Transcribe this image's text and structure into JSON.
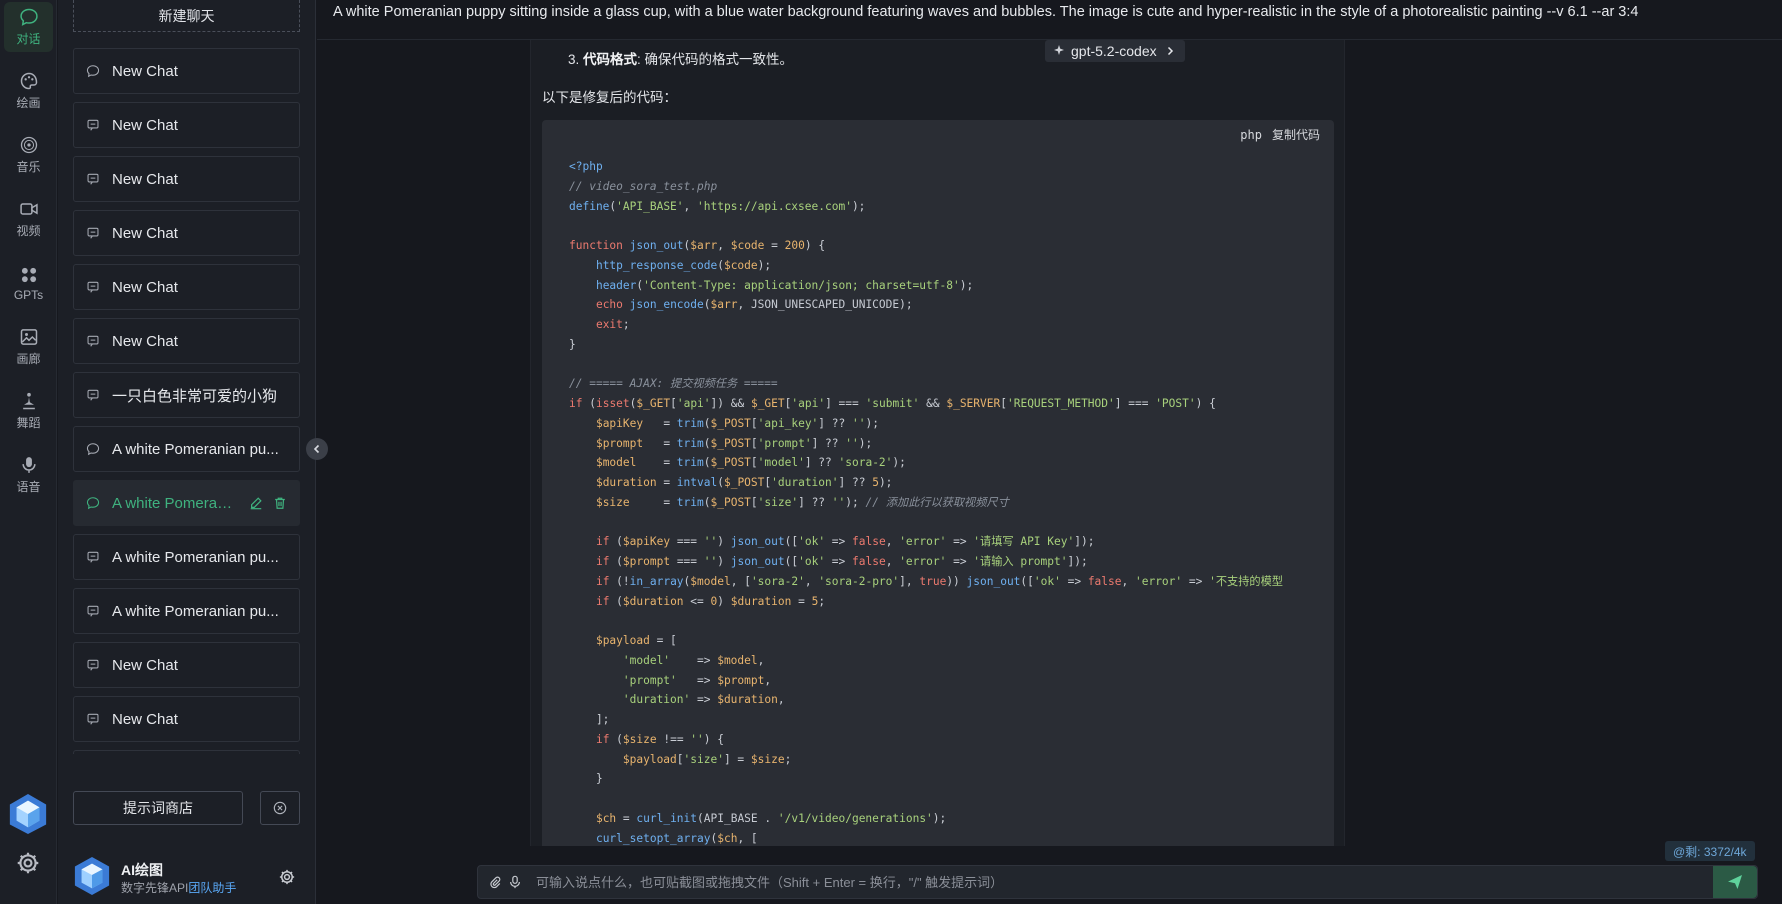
{
  "rail": {
    "items": [
      {
        "label": "对话",
        "icon": "chat-bubble-icon",
        "active": true
      },
      {
        "label": "绘画",
        "icon": "palette-icon"
      },
      {
        "label": "音乐",
        "icon": "music-disc-icon"
      },
      {
        "label": "视频",
        "icon": "video-camera-icon"
      },
      {
        "label": "GPTs",
        "icon": "grid-apps-icon"
      },
      {
        "label": "画廊",
        "icon": "image-gallery-icon"
      },
      {
        "label": "舞蹈",
        "icon": "dance-icon"
      },
      {
        "label": "语音",
        "icon": "microphone-icon"
      }
    ]
  },
  "sidebar": {
    "new_chat_label": "新建聊天",
    "chats": [
      {
        "label": "New Chat",
        "icon": "chat-bubble-icon"
      },
      {
        "label": "New Chat",
        "icon": "message-square-icon"
      },
      {
        "label": "New Chat",
        "icon": "message-square-icon"
      },
      {
        "label": "New Chat",
        "icon": "message-square-icon"
      },
      {
        "label": "New Chat",
        "icon": "message-square-icon"
      },
      {
        "label": "New Chat",
        "icon": "message-square-icon"
      },
      {
        "label": "一只白色非常可爱的小狗",
        "icon": "message-square-icon"
      },
      {
        "label": "A white Pomeranian pu...",
        "icon": "chat-bubble-icon"
      },
      {
        "label": "A white Pomerani...",
        "icon": "chat-bubble-icon",
        "active": true
      },
      {
        "label": "A white Pomeranian pu...",
        "icon": "message-square-icon"
      },
      {
        "label": "A white Pomeranian pu...",
        "icon": "message-square-icon"
      },
      {
        "label": "New Chat",
        "icon": "message-square-icon"
      },
      {
        "label": "New Chat",
        "icon": "message-square-icon"
      },
      {
        "label": "",
        "icon": "message-square-icon"
      }
    ],
    "prompt_store_label": "提示词商店",
    "profile": {
      "name": "AI绘图",
      "subtitle": "数字先锋API",
      "link": "团队助手"
    }
  },
  "header": {
    "title": "A white Pomeranian puppy sitting inside a glass cup, with a blue water background featuring waves and bubbles. The image is cute and hyper-realistic in the style of a photorealistic painting --v 6.1 --ar 3:4"
  },
  "message": {
    "model_label": "gpt-5.2-codex",
    "list_item_number": "3.",
    "list_item_bold": "代码格式",
    "list_item_text": ": 确保代码的格式一致性。",
    "intro": "以下是修复后的代码：",
    "code_lang": "php",
    "copy_label": "复制代码",
    "code_lines": [
      "<?php",
      "// video_sora_test.php",
      "define('API_BASE', 'https://api.cxsee.com');",
      "",
      "function json_out($arr, $code = 200) {",
      "    http_response_code($code);",
      "    header('Content-Type: application/json; charset=utf-8');",
      "    echo json_encode($arr, JSON_UNESCAPED_UNICODE);",
      "    exit;",
      "}",
      "",
      "// ===== AJAX: 提交视频任务 =====",
      "if (isset($_GET['api']) && $_GET['api'] === 'submit' && $_SERVER['REQUEST_METHOD'] === 'POST') {",
      "    $apiKey   = trim($_POST['api_key'] ?? '');",
      "    $prompt   = trim($_POST['prompt'] ?? '');",
      "    $model    = trim($_POST['model'] ?? 'sora-2');",
      "    $duration = intval($_POST['duration'] ?? 5);",
      "    $size     = trim($_POST['size'] ?? ''); // 添加此行以获取视频尺寸",
      "",
      "    if ($apiKey === '') json_out(['ok' => false, 'error' => '请填写 API Key']);",
      "    if ($prompt === '') json_out(['ok' => false, 'error' => '请输入 prompt']);",
      "    if (!in_array($model, ['sora-2', 'sora-2-pro'], true)) json_out(['ok' => false, 'error' => '不支持的模型",
      "    if ($duration <= 0) $duration = 5;",
      "",
      "    $payload = [",
      "        'model'    => $model,",
      "        'prompt'   => $prompt,",
      "        'duration' => $duration,",
      "    ];",
      "    if ($size !== '') {",
      "        $payload['size'] = $size;",
      "    }",
      "",
      "    $ch = curl_init(API_BASE . '/v1/video/generations');",
      "    curl_setopt_array($ch, ["
    ]
  },
  "composer": {
    "token_badge": "@剩: 3372/4k",
    "placeholder": "可输入说点什么，也可贴截图或拖拽文件（Shift + Enter = 换行，\"/\" 触发提示词）"
  }
}
